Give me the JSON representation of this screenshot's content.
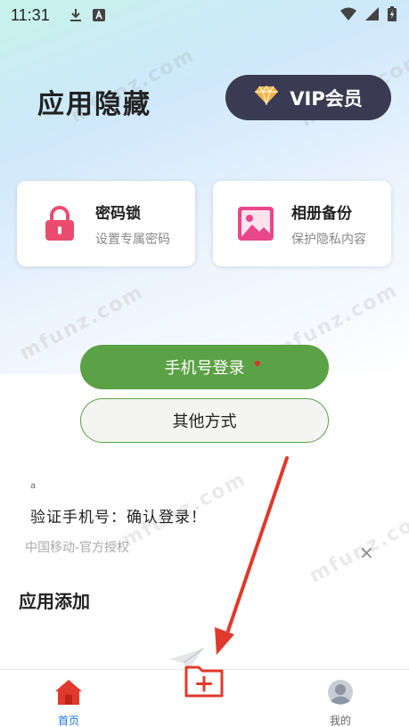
{
  "status_bar": {
    "time": "11:31"
  },
  "header": {
    "title": "应用隐藏",
    "vip_label": "VIP会员"
  },
  "cards": [
    {
      "title": "密码锁",
      "subtitle": "设置专属密码"
    },
    {
      "title": "相册备份",
      "subtitle": "保护隐私内容"
    }
  ],
  "login": {
    "phone_label": "手机号登录",
    "other_label": "其他方式",
    "small_glyph": "a",
    "verify_text": "验证手机号：确认登录！",
    "carrier_text": "中国移动-官方授权",
    "close_symbol": "×"
  },
  "section": {
    "title": "应用添加"
  },
  "watermark": "mfunz.com",
  "bottom_nav": {
    "home_label": "首页",
    "mine_label": "我的"
  },
  "colors": {
    "accent_green": "#5ba145",
    "vip_bg": "#3a3b52",
    "nav_active": "#1e73e8",
    "arrow_red": "#e0392b"
  }
}
